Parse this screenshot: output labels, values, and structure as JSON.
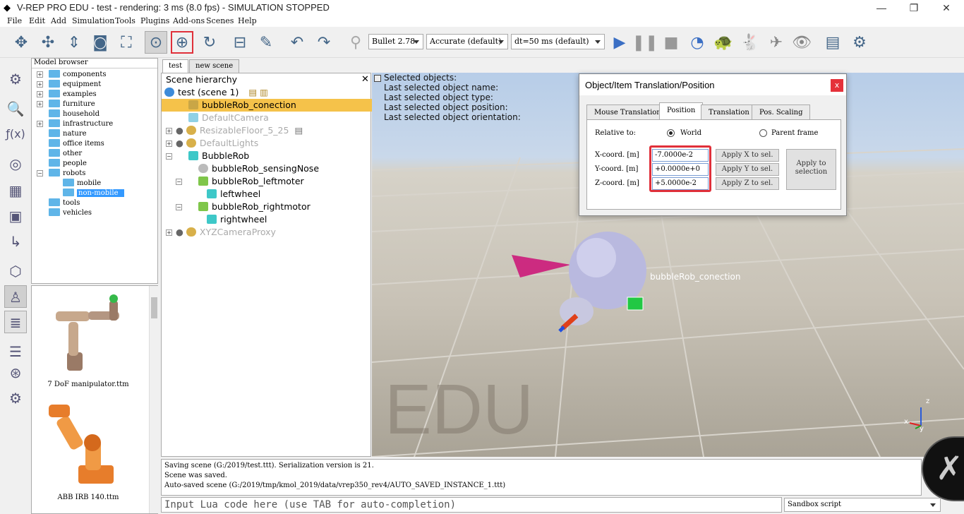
{
  "window": {
    "title": "V-REP PRO EDU - test - rendering: 3 ms (8.0 fps) - SIMULATION STOPPED",
    "minimize": "—",
    "restore": "❐",
    "close": "✕"
  },
  "menu": [
    "File",
    "Edit",
    "Add",
    "Simulation",
    "Tools",
    "Plugins",
    "Add-ons",
    "Scenes",
    "Help"
  ],
  "toolbar": {
    "engine": "Bullet 2.78",
    "accuracy": "Accurate (default)",
    "timestep": "dt=50 ms (default)"
  },
  "model_browser": {
    "title": "Model browser",
    "items": [
      "components",
      "equipment",
      "examples",
      "furniture",
      "household",
      "infrastructure",
      "nature",
      "office items",
      "other",
      "people",
      "robots",
      "mobile",
      "non-mobile",
      "tools",
      "vehicles"
    ],
    "selected": "non-mobile"
  },
  "thumbnails": [
    "7 DoF manipulator.ttm",
    "ABB IRB 140.ttm"
  ],
  "scene_tabs": [
    "test",
    "new scene"
  ],
  "hierarchy": {
    "title": "Scene hierarchy",
    "close": "✕",
    "rows": [
      "test (scene 1)",
      "bubbleRob_conection",
      "DefaultCamera",
      "ResizableFloor_5_25",
      "DefaultLights",
      "BubbleRob",
      "bubbleRob_sensingNose",
      "bubbleRob_leftmoter",
      "leftwheel",
      "bubbleRob_rightmotor",
      "rightwheel",
      "XYZCameraProxy"
    ]
  },
  "viewport": {
    "info": [
      "Selected objects:",
      "Last selected object name:",
      "Last selected object type:",
      "Last selected object position:",
      "Last selected object orientation:"
    ],
    "object_label": "bubbleRob_conection",
    "watermark": "EDU",
    "axis_x": "x",
    "axis_y": "y",
    "axis_z": "z"
  },
  "dialog": {
    "title": "Object/Item Translation/Position",
    "close": "x",
    "tabs": [
      "Mouse Translation",
      "Position",
      "Translation",
      "Pos. Scaling"
    ],
    "active_tab": "Position",
    "relative_to": "Relative to:",
    "world": "World",
    "parent_frame": "Parent frame",
    "x_label": "X-coord. [m]",
    "y_label": "Y-coord. [m]",
    "z_label": "Z-coord. [m]",
    "x_value": "-7.0000e-2",
    "y_value": "+0.0000e+0",
    "z_value": "+5.0000e-2",
    "apply_x": "Apply X to sel.",
    "apply_y": "Apply Y to sel.",
    "apply_z": "Apply Z to sel.",
    "apply_sel_1": "Apply to",
    "apply_sel_2": "selection"
  },
  "console": [
    "Saving scene (G:/2019/test.ttt). Serialization version is 21.",
    "Scene was saved.",
    "Auto-saved scene (G:/2019/tmp/kmol_2019/data/vrep350_rev4/AUTO_SAVED_INSTANCE_1.ttt)"
  ],
  "lua_input_placeholder": "Input Lua code here (use TAB for auto-completion)",
  "script_selector": "Sandbox script"
}
